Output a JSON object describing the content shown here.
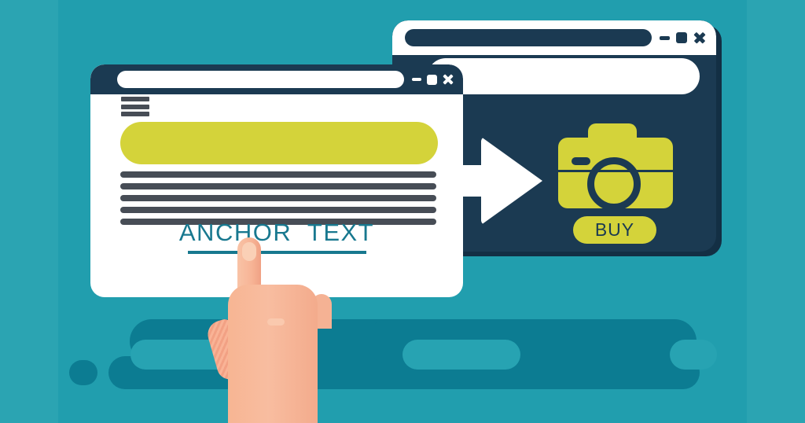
{
  "scene": {
    "title": "Anchor text backlink illustration",
    "colors": {
      "background_outer": "#2ba4b2",
      "background_panel": "#219eae",
      "blob_dark": "#0c7c92",
      "blob_light": "#27a3b2",
      "navy": "#1b3a52",
      "navy_shadow": "#132f44",
      "yellow": "#d4d33a",
      "link_teal": "#18788f",
      "text_gray": "#474d56",
      "white": "#ffffff",
      "skin": "#f8bda0",
      "skin_dark": "#f0a184"
    }
  },
  "left_window": {
    "name": "Source page browser window",
    "titlebar": {
      "urlbar_value": "",
      "urlbar_placeholder": "",
      "controls": [
        {
          "name": "minimize",
          "glyph": "–"
        },
        {
          "name": "maximize",
          "glyph": "□"
        },
        {
          "name": "close",
          "glyph": "✕"
        }
      ]
    },
    "menu_icon_label": "Menu",
    "hero_banner_label": "",
    "paragraph_lines": 5,
    "anchor_link": {
      "label": "ANCHOR  TEXT",
      "underlined": true,
      "color": "#18788f"
    }
  },
  "right_window": {
    "name": "Destination product browser window",
    "titlebar": {
      "urlbar_value": "",
      "urlbar_placeholder": "",
      "controls": [
        {
          "name": "minimize",
          "glyph": "–"
        },
        {
          "name": "maximize",
          "glyph": "□"
        },
        {
          "name": "close",
          "glyph": "✕"
        }
      ]
    },
    "searchbar_value": "",
    "searchbar_placeholder": "",
    "product": {
      "icon_name": "camera-icon",
      "buy_button_label": "BUY"
    }
  },
  "arrow": {
    "name": "link-flow-arrow",
    "direction": "right",
    "color": "#ffffff"
  },
  "hand": {
    "name": "pointing-hand-cursor",
    "gesture": "index finger pointing up at the anchor link"
  }
}
